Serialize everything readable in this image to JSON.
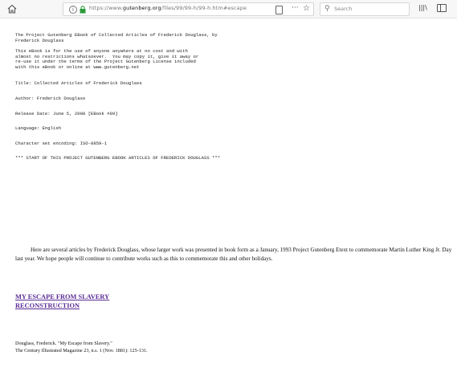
{
  "browser": {
    "url_prefix": "https://www.",
    "url_domain": "gutenberg.org",
    "url_path": "/files/99/99-h/99-h.htm#escape",
    "search_placeholder": "Search",
    "more_glyph": "···",
    "star_glyph": "☆",
    "search_glyph": "⚲",
    "library_glyph": "|||\\",
    "info_glyph": "i"
  },
  "header": {
    "line1": "The Project Gutenberg EBook of Collected Articles of Frederick Douglass, by",
    "line2": "Frederick Douglass",
    "license1": "This eBook is for the use of anyone anywhere at no cost and with",
    "license2": "almost no restrictions whatsoever.  You may copy it, give it away or",
    "license3": "re-use it under the terms of the Project Gutenberg License included",
    "license4": "with this eBook or online at www.gutenberg.net",
    "title": "Title: Collected Articles of Frederick Douglass",
    "author": "Author: Frederick Douglass",
    "release": "Release Date: June 5, 2008 [EBook #99]",
    "language": "Language: English",
    "encoding": "Character set encoding: ISO-8859-1",
    "start": "*** START OF THIS PROJECT GUTENBERG EBOOK ARTICLES OF FREDERICK DOUGLASS ***"
  },
  "intro": "Here are several articles by Frederick Douglass, whose larger work was presented in book form as a January, 1993 Project Gutenberg Etext to commemorate Martin Luther King Jr. Day last year. We hope people will continue to contribute works such as this to commemorate this and other holidays.",
  "toc": {
    "link1": "MY ESCAPE FROM SLAVERY",
    "link2": "RECONSTRUCTION"
  },
  "citation": {
    "line1": "Douglass, Frederick. \"My Escape from Slavery.\"",
    "line2": "The Century Illustrated Magazine 23, n.s. 1 (Nov. 1881): 125-131."
  }
}
